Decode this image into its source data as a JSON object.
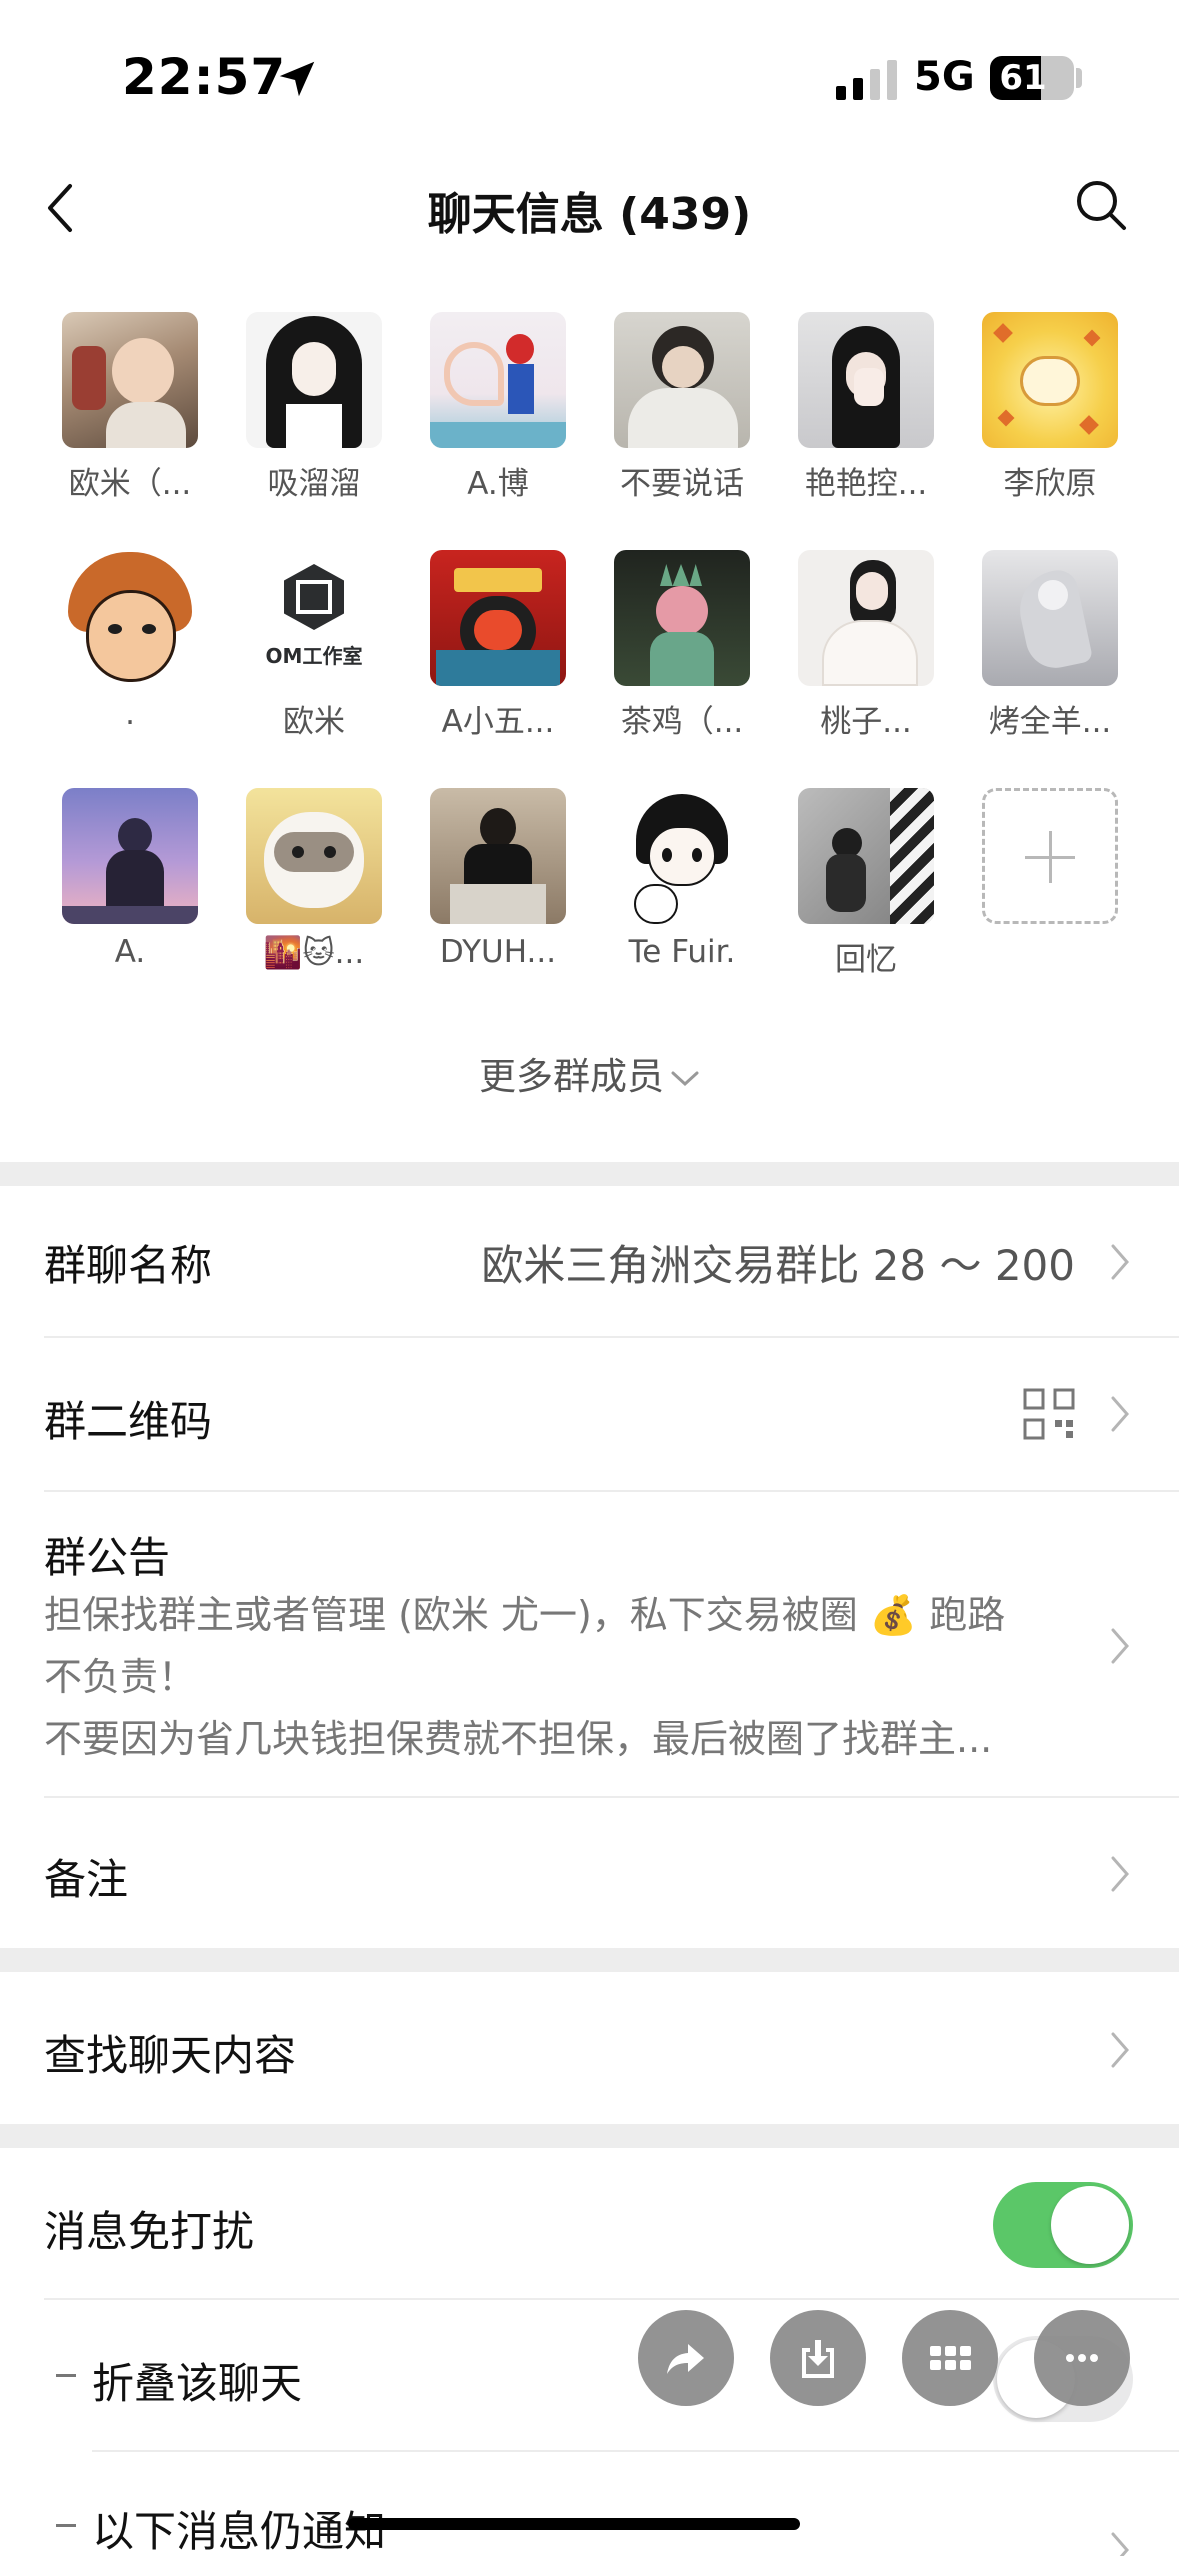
{
  "status_bar": {
    "time": "22:57",
    "network": "5G",
    "battery": "61",
    "battery_level": 0.61
  },
  "nav": {
    "title": "聊天信息 (439)"
  },
  "members": [
    {
      "name": "欧米（...",
      "avatar": "toddler-photo"
    },
    {
      "name": "吸溜溜",
      "avatar": "anime-girl-black-hair"
    },
    {
      "name": "A.博",
      "avatar": "heart-hands-spiderman"
    },
    {
      "name": "不要说话",
      "avatar": "person-white-hoodie"
    },
    {
      "name": "艳艳控...",
      "avatar": "girl-covering-face"
    },
    {
      "name": "李欣原",
      "avatar": "yellow-cartoon-sun"
    },
    {
      "name": ".",
      "avatar": "cartoon-boy-orange-hair"
    },
    {
      "name": "欧米",
      "avatar": "om-studio-logo"
    },
    {
      "name": "A小五...",
      "avatar": "red-deity-poster"
    },
    {
      "name": "茶鸡（...",
      "avatar": "statue-of-liberty-pink-hair"
    },
    {
      "name": "桃子...",
      "avatar": "girl-white-outfit"
    },
    {
      "name": "烤全羊...",
      "avatar": "grey-figure-art"
    },
    {
      "name": "A.",
      "avatar": "purple-sky-boy"
    },
    {
      "name": "🌇🐱...",
      "avatar": "fluffy-cat"
    },
    {
      "name": "DYUH...",
      "avatar": "man-sitting-sofa"
    },
    {
      "name": "Te Fuir.",
      "avatar": "anime-boy-with-cat"
    },
    {
      "name": "回忆",
      "avatar": "bw-street-person"
    }
  ],
  "add_member_icon": "plus-icon",
  "more_members": "更多群成员",
  "settings": {
    "group_name_label": "群聊名称",
    "group_name_value": "欧米三角洲交易群比 28 ～ 200",
    "qr_label": "群二维码",
    "notice_label": "群公告",
    "notice_line1": "担保找群主或者管理 (欧米 尤一)，私下交易被圈 💰 跑路",
    "notice_line2": "不负责！",
    "notice_line3": "不要因为省几块钱担保费就不担保，最后被圈了找群主...",
    "remark_label": "备注",
    "search_chat_label": "查找聊天内容",
    "mute_label": "消息免打扰",
    "mute_on": true,
    "fold_label": "折叠该聊天",
    "fold_on": false,
    "notify_label": "以下消息仍通知"
  },
  "floating_actions": [
    "share-icon",
    "download-icon",
    "grid-icon",
    "more-icon"
  ],
  "colors": {
    "toggle_on": "#5bc768",
    "section_gap": "#ededed"
  }
}
